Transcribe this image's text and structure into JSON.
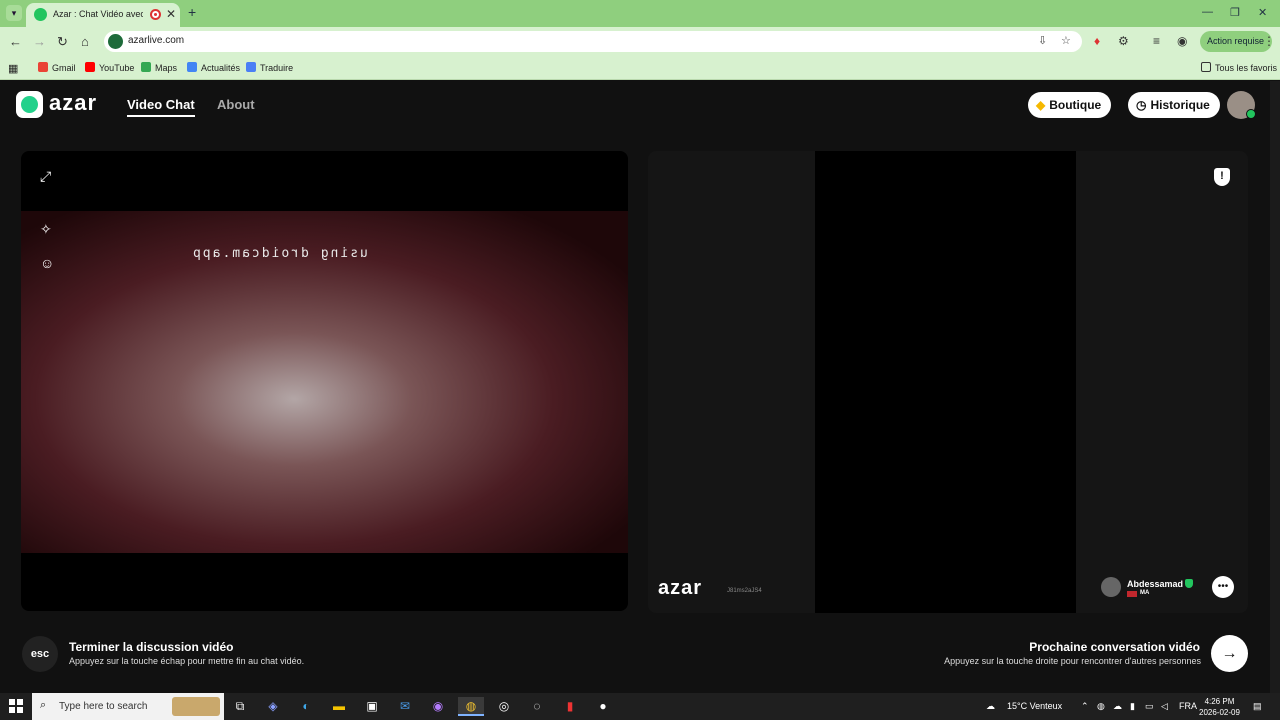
{
  "browser": {
    "tab_title": "Azar : Chat Vidéo avec de n",
    "url": "azarlive.com",
    "action_label": "Action requise",
    "bookmarks": [
      "Gmail",
      "YouTube",
      "Maps",
      "Actualités",
      "Traduire"
    ],
    "all_bookmarks": "Tous les favoris"
  },
  "header": {
    "logo": "azar",
    "nav": [
      "Video Chat",
      "About"
    ],
    "shop_label": "Boutique",
    "history_label": "Historique"
  },
  "local_video": {
    "watermark": "using droidcam.app"
  },
  "remote": {
    "logo": "azar",
    "id": "J81ms2aJS4",
    "peer_name": "Abdessamad",
    "peer_country": "MA"
  },
  "footer": {
    "esc_key": "esc",
    "end_title": "Terminer la discussion vidéo",
    "end_sub": "Appuyez sur la touche échap pour mettre fin au chat vidéo.",
    "next_title": "Prochaine conversation vidéo",
    "next_sub": "Appuyez sur la touche droite pour rencontrer d'autres personnes"
  },
  "taskbar": {
    "search_placeholder": "Type here to search",
    "weather": "15°C  Venteux",
    "lang": "FRA",
    "time": "4:26 PM",
    "date": "2026-02-09"
  },
  "icons": {
    "menu": "chevron-down-icon",
    "expand": "expand-icon",
    "magic": "magic-wand-icon",
    "face": "face-icon",
    "report": "report-shield-icon",
    "chat": "chat-bubble-icon",
    "next": "arrow-right-icon"
  }
}
